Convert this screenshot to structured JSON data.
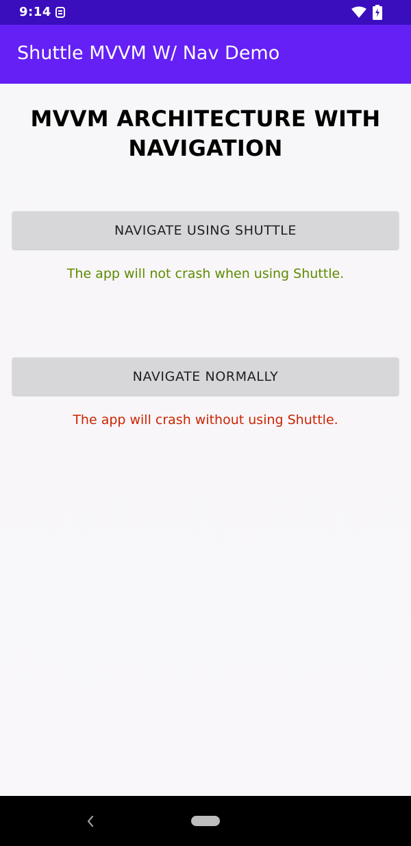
{
  "status_bar": {
    "time": "9:14",
    "background_color": "#3a0ebd",
    "icons": [
      "notification-icon",
      "wifi-icon",
      "battery-icon"
    ]
  },
  "app_bar": {
    "title": "Shuttle MVVM W/ Nav Demo",
    "background_color": "#6420f5"
  },
  "main": {
    "heading": "MVVM ARCHITECTURE WITH NAVIGATION",
    "shuttle_button_label": "NAVIGATE USING SHUTTLE",
    "shuttle_note": "The app will not crash when using Shuttle.",
    "shuttle_note_color": "#5d8a00",
    "normal_button_label": "NAVIGATE NORMALLY",
    "normal_note": "The app will crash without using Shuttle.",
    "normal_note_color": "#cc2300"
  },
  "nav_bar": {
    "icons": [
      "back-icon",
      "home-pill"
    ]
  }
}
